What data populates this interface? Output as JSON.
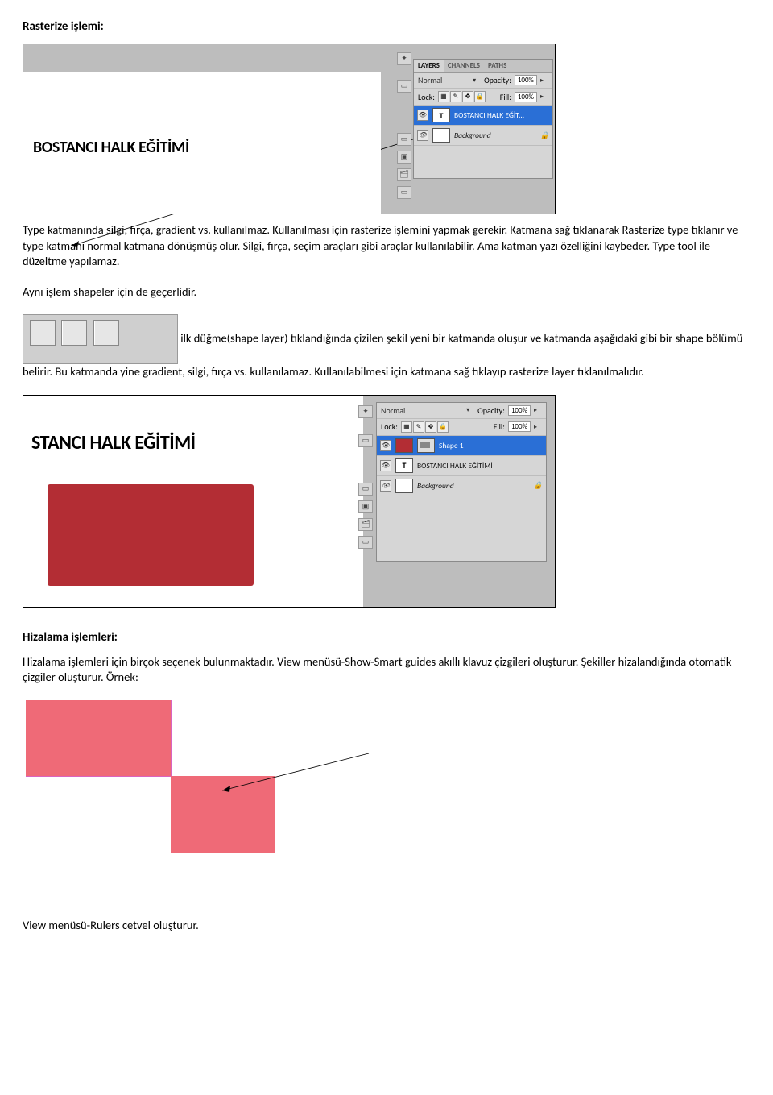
{
  "heading1": "Rasterize işlemi:",
  "img1": {
    "canvas_text": "BOSTANCI HALK EĞİTİMİ",
    "tabs": {
      "layers": "LAYERS",
      "channels": "CHANNELS",
      "paths": "PATHS"
    },
    "blend": {
      "label": "Normal",
      "opacity_label": "Opacity:",
      "opacity_val": "100%"
    },
    "lock": {
      "label": "Lock:",
      "fill_label": "Fill:",
      "fill_val": "100%"
    },
    "layer_text_name": "BOSTANCI HALK EĞİT...",
    "layer_bg_name": "Background"
  },
  "para1": "Type katmanında silgi, fırça, gradient vs. kullanılmaz. Kullanılması için rasterize işlemini yapmak gerekir. Katmana sağ tıklanarak Rasterize type tıklanır ve type katmanı normal katmana dönüşmüş olur. Silgi, fırça, seçim araçları gibi araçlar kullanılabilir. Ama katman yazı özelliğini kaybeder. Type tool ile düzeltme yapılamaz.",
  "para2": "Aynı işlem shapeler için de geçerlidir.",
  "para3": "ilk düğme(shape layer) tıklandığında çizilen şekil yeni bir katmanda oluşur ve katmanda aşağıdaki gibi bir shape bölümü belirir. Bu katmanda yine gradient, silgi, fırça vs. kullanılamaz. Kullanılabilmesi için katmana sağ tıklayıp rasterize layer tıklanılmalıdır.",
  "img2": {
    "canvas_text": "STANCI HALK EĞİTİMİ",
    "blend": {
      "label": "Normal",
      "opacity_label": "Opacity:",
      "opacity_val": "100%"
    },
    "lock": {
      "label": "Lock:",
      "fill_label": "Fill:",
      "fill_val": "100%"
    },
    "shape_layer": "Shape 1",
    "text_layer": "BOSTANCI HALK EĞİTİMİ",
    "bg_layer": "Background"
  },
  "heading2": "Hizalama işlemleri:",
  "para4": "Hizalama işlemleri için birçok seçenek bulunmaktadır. View menüsü-Show-Smart guides akıllı klavuz çizgileri oluşturur. Şekiller hizalandığında otomatik çizgiler oluşturur. Örnek:",
  "para5": "View menüsü-Rulers cetvel oluşturur."
}
